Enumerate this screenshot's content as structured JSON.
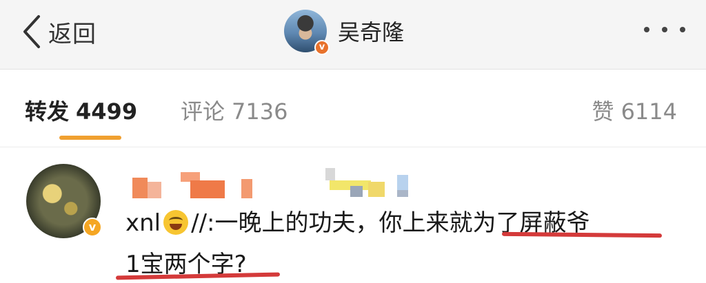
{
  "navbar": {
    "back_label": "返回",
    "profile_name": "吴奇隆",
    "verified_mark": "v"
  },
  "tabs": [
    {
      "label": "转发",
      "count": "4499",
      "active": true
    },
    {
      "label": "评论",
      "count": "7136",
      "active": false
    },
    {
      "label": "赞",
      "count": "6114",
      "active": false
    }
  ],
  "comment": {
    "verified_mark": "v",
    "line1_prefix": "xnl",
    "line1_main": "//:一晚上的功夫，你上来就为了屏蔽爷",
    "line2": "1宝两个字?"
  },
  "colors": {
    "tab_indicator": "#f0a030",
    "underline": "#d43a3a",
    "navbar_bg": "#f5f5f5"
  },
  "icons": [
    "back-chevron-icon",
    "more-icon",
    "laughing-emoji-icon",
    "verified-badge-icon"
  ]
}
